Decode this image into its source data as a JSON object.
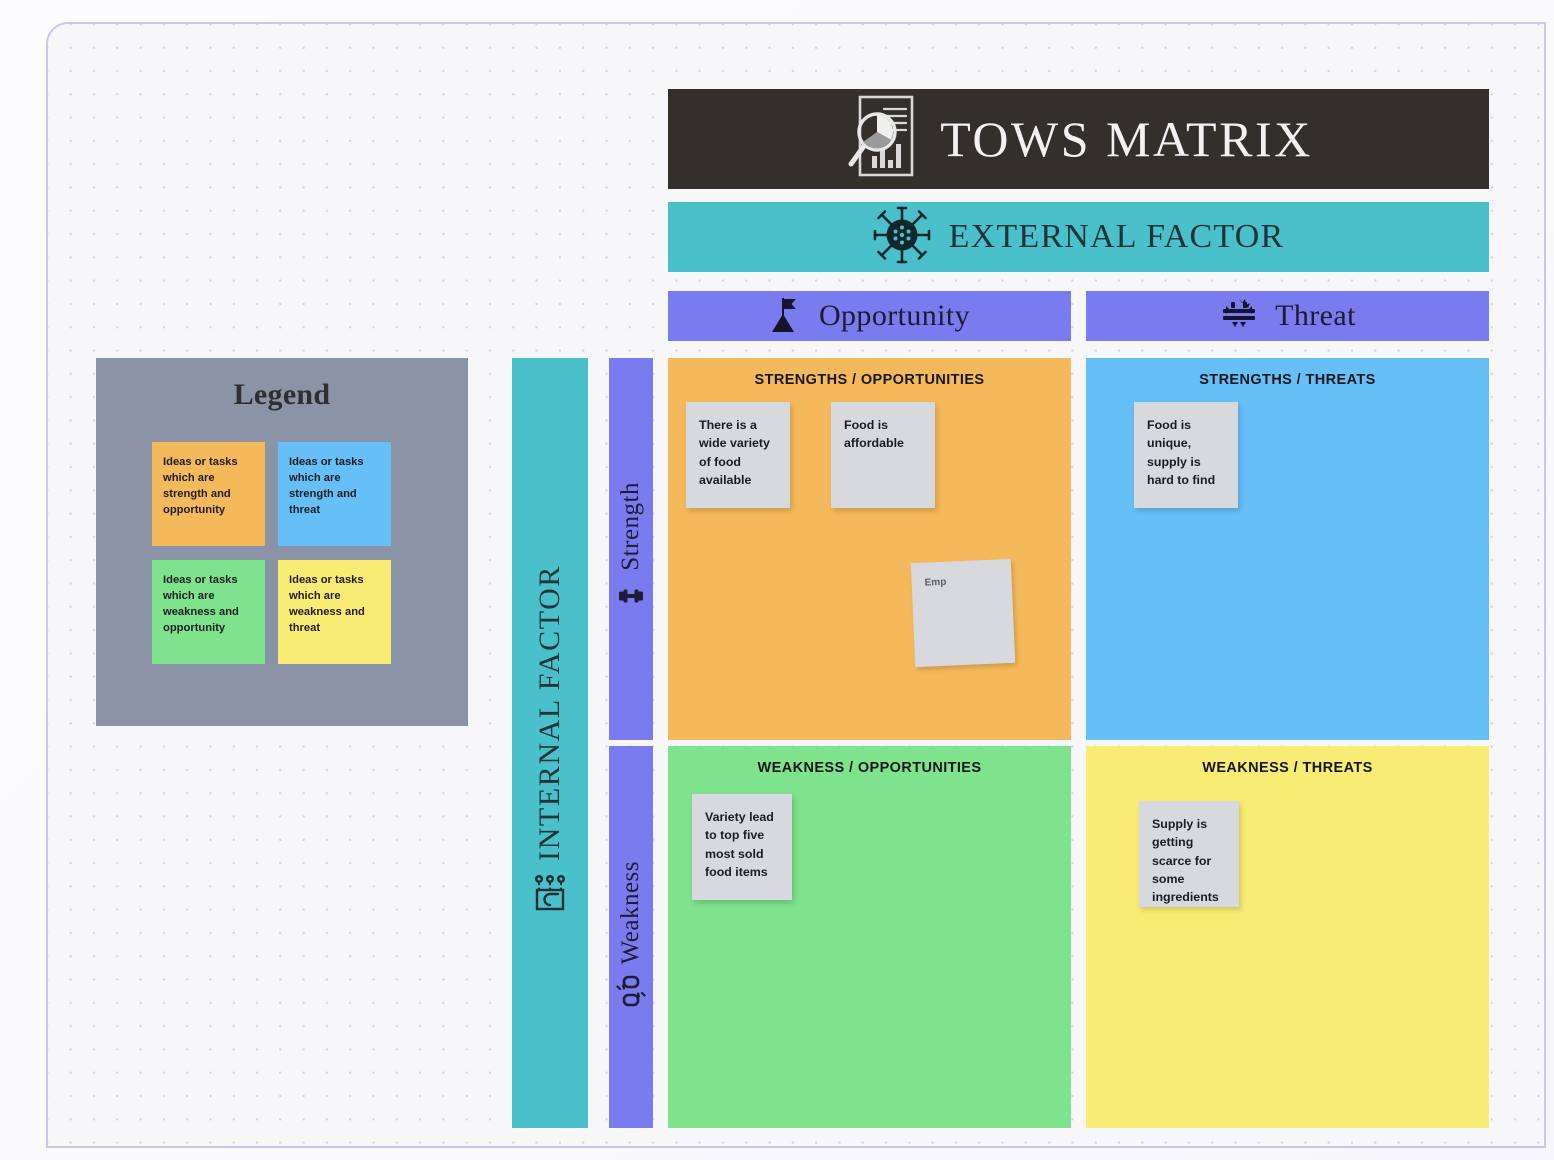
{
  "title_bar": {
    "text": "TOWS MATRIX",
    "icon": "report-analysis-icon",
    "bg": "#332F2B"
  },
  "external_bar": {
    "text": "EXTERNAL FACTOR",
    "icon": "virus-icon",
    "bg": "#49C0CA"
  },
  "internal_bar": {
    "text": "INTERNAL FACTOR",
    "icon": "process-flow-icon",
    "bg": "#49C0CA"
  },
  "columns": [
    {
      "label": "Opportunity",
      "icon": "flag-summit-icon",
      "bg": "#7B7BF0"
    },
    {
      "label": "Threat",
      "icon": "broken-shield-icon",
      "bg": "#7B7BF0"
    }
  ],
  "rows": [
    {
      "label": "Strength",
      "icon": "dumbbell-icon",
      "bg": "#7B7BF0"
    },
    {
      "label": "Weakness",
      "icon": "broken-chain-icon",
      "bg": "#7B7BF0"
    }
  ],
  "legend": {
    "title": "Legend",
    "bg": "#8B93A6",
    "cards": [
      {
        "text": "Ideas or tasks which are strength and opportunity",
        "color": "#F4B95B"
      },
      {
        "text": "Ideas or tasks which are strength and threat",
        "color": "#66BFF7"
      },
      {
        "text": "Ideas or tasks which are weakness and opportunity",
        "color": "#7FE28C"
      },
      {
        "text": "Ideas or tasks which are weakness and threat",
        "color": "#F9EC74"
      }
    ]
  },
  "quadrants": {
    "strengths_opportunities": {
      "title": "STRENGTHS / OPPORTUNITIES",
      "bg": "#F4B95B",
      "notes": [
        {
          "text": "There is a wide variety of food available"
        },
        {
          "text": "Food is affordable"
        },
        {
          "text": "Emp"
        }
      ]
    },
    "strengths_threats": {
      "title": "STRENGTHS / THREATS",
      "bg": "#66BFF7",
      "notes": [
        {
          "text": "Food is unique, supply is hard to find"
        }
      ]
    },
    "weakness_opportunities": {
      "title": "WEAKNESS / OPPORTUNITIES",
      "bg": "#7FE28C",
      "notes": [
        {
          "text": "Variety lead to top five most sold food items"
        }
      ]
    },
    "weakness_threats": {
      "title": "WEAKNESS / THREATS",
      "bg": "#F9EC74",
      "notes": [
        {
          "text": "Supply is getting scarce for some ingredients"
        }
      ]
    }
  }
}
